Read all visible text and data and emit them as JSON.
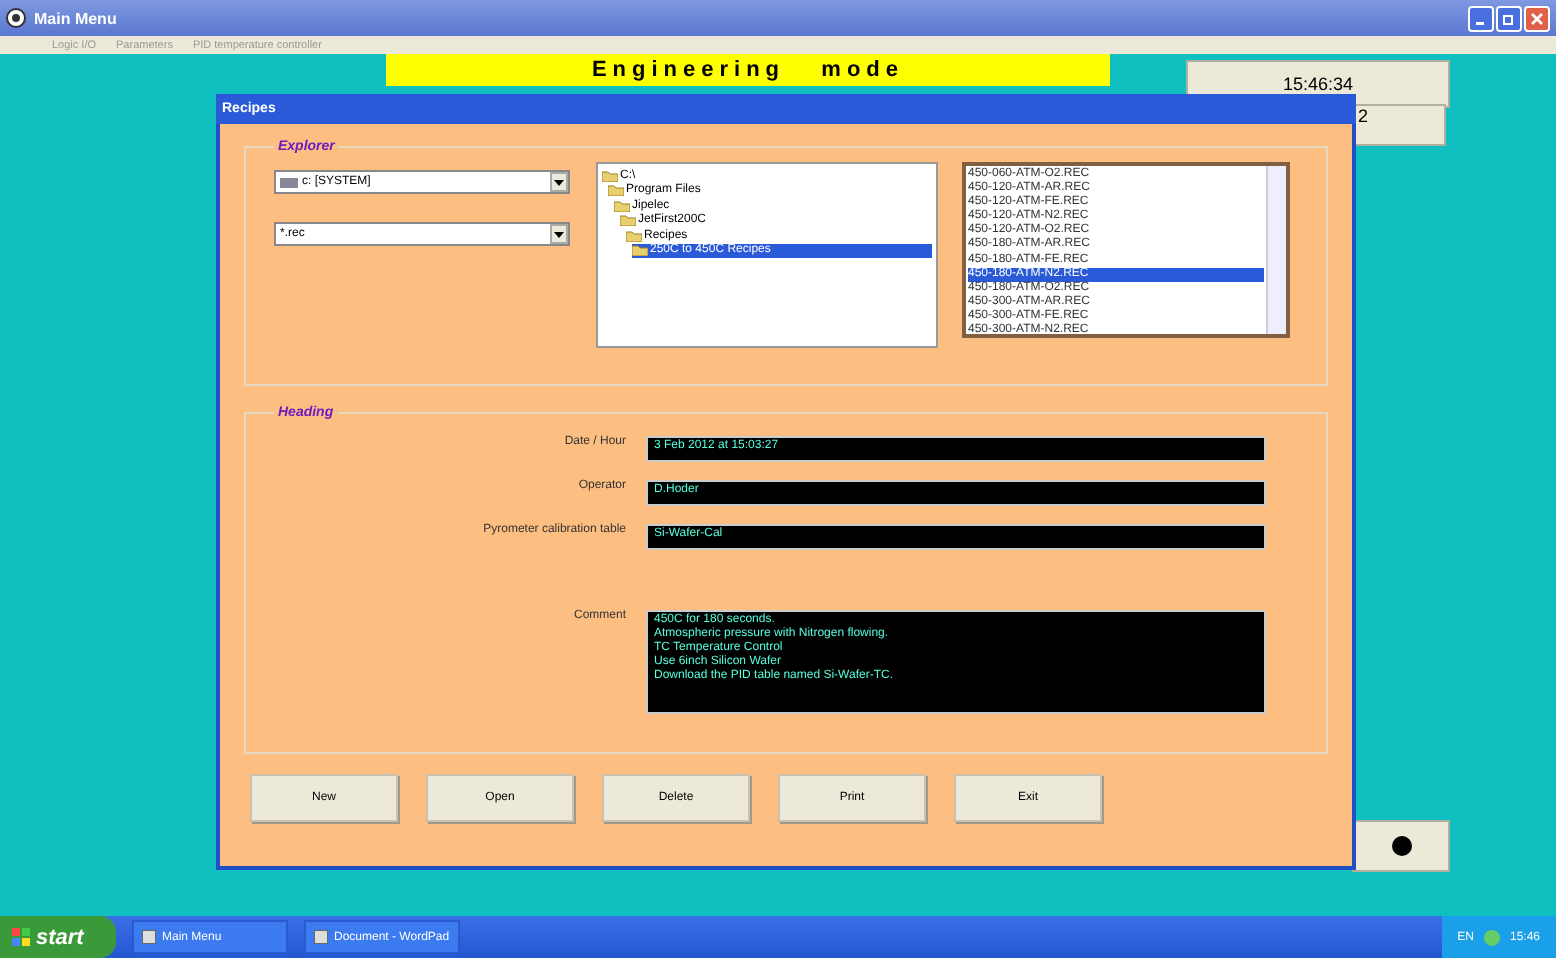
{
  "window": {
    "title": "Main Menu"
  },
  "menu": [
    "Logic I/O",
    "Parameters",
    "PID temperature controller"
  ],
  "banner": "Engineering   mode",
  "clock": "15:46:34",
  "side_box": "2",
  "dialog": {
    "title": "Recipes",
    "explorer": {
      "title": "Explorer",
      "drive": "c: [SYSTEM]",
      "filter": "*.rec",
      "tree": [
        {
          "label": "C:\\",
          "selected": false,
          "children": [
            {
              "label": "Program Files",
              "selected": false,
              "children": [
                {
                  "label": "Jipelec",
                  "selected": false,
                  "children": [
                    {
                      "label": "JetFirst200C",
                      "selected": false,
                      "children": [
                        {
                          "label": "Recipes",
                          "selected": false,
                          "children": [
                            {
                              "label": "250C to 450C Recipes",
                              "selected": true
                            }
                          ]
                        }
                      ]
                    }
                  ]
                }
              ]
            }
          ]
        }
      ],
      "files": [
        {
          "label": "450-060-ATM-O2.REC",
          "selected": false
        },
        {
          "label": "450-120-ATM-AR.REC",
          "selected": false
        },
        {
          "label": "450-120-ATM-FE.REC",
          "selected": false
        },
        {
          "label": "450-120-ATM-N2.REC",
          "selected": false
        },
        {
          "label": "450-120-ATM-O2.REC",
          "selected": false
        },
        {
          "label": "450-180-ATM-AR.REC",
          "selected": false
        },
        {
          "label": "450-180-ATM-FE.REC",
          "selected": false
        },
        {
          "label": "450-180-ATM-N2.REC",
          "selected": true
        },
        {
          "label": "450-180-ATM-O2.REC",
          "selected": false
        },
        {
          "label": "450-300-ATM-AR.REC",
          "selected": false
        },
        {
          "label": "450-300-ATM-FE.REC",
          "selected": false
        },
        {
          "label": "450-300-ATM-N2.REC",
          "selected": false
        }
      ]
    },
    "heading": {
      "title": "Heading",
      "fields": [
        {
          "label": "Date / Hour",
          "value": "3 Feb 2012 at 15:03:27",
          "kind": "line"
        },
        {
          "label": "Operator",
          "value": "D.Hoder",
          "kind": "line"
        },
        {
          "label": "Pyrometer calibration table",
          "value": "Si-Wafer-Cal",
          "kind": "line"
        },
        {
          "label": "Comment",
          "value": "450C for 180 seconds.\nAtmospheric pressure with Nitrogen flowing.\nTC Temperature Control\nUse 6inch Silicon Wafer\nDownload the PID table named Si-Wafer-TC.",
          "kind": "memo"
        }
      ]
    },
    "buttons": [
      "New",
      "Open",
      "Delete",
      "Print",
      "Exit"
    ]
  },
  "taskbar": {
    "start": "start",
    "tasks": [
      "Main Menu",
      "Document - WordPad"
    ],
    "language": "EN",
    "time": "15:46"
  }
}
